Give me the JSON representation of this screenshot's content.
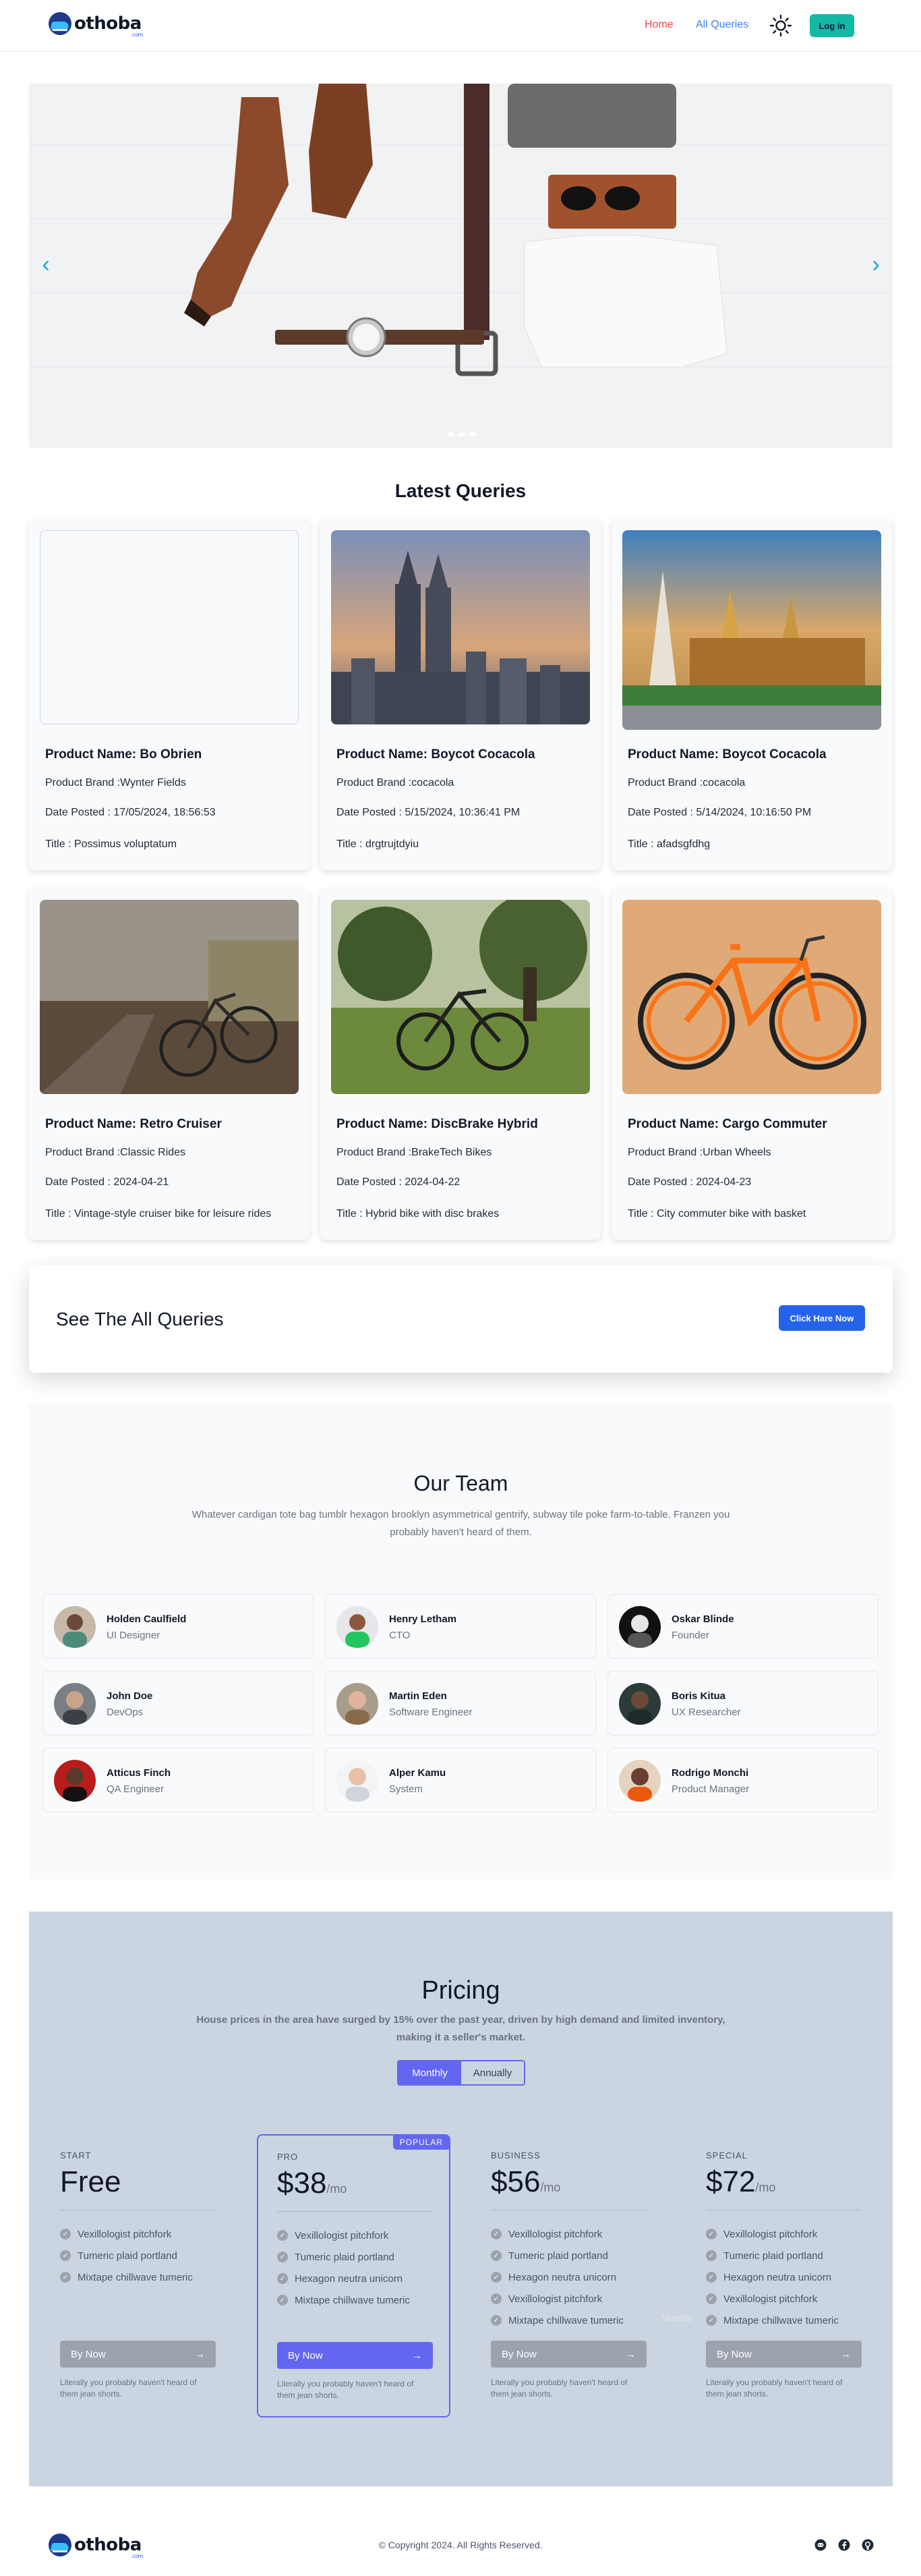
{
  "nav": {
    "logo_text": "othoba",
    "logo_sub": ".com",
    "home_label": "Home",
    "queries_label": "All Queries",
    "theme_icon": "sun-icon",
    "login_label": "Log in"
  },
  "hero": {
    "prev_icon": "chevron-left-icon",
    "next_icon": "chevron-right-icon",
    "slides": 3
  },
  "latest": {
    "heading": "Latest Queries",
    "cards": [
      {
        "name": "Product Name: Bo Obrien",
        "brand": "Product Brand :Wynter Fields",
        "date": "Date Posted : 17/05/2024, 18:56:53",
        "title": "Title : Possimus voluptatum"
      },
      {
        "name": "Product Name: Boycot Cocacola",
        "brand": "Product Brand :cocacola",
        "date": "Date Posted : 5/15/2024, 10:36:41 PM",
        "title": "Title : drgtrujtdyiu"
      },
      {
        "name": "Product Name: Boycot Cocacola",
        "brand": "Product Brand :cocacola",
        "date": "Date Posted : 5/14/2024, 10:16:50 PM",
        "title": "Title : afadsgfdhg"
      },
      {
        "name": "Product Name: Retro Cruiser",
        "brand": "Product Brand :Classic Rides",
        "date": "Date Posted : 2024-04-21",
        "title": "Title : Vintage-style cruiser bike for leisure rides"
      },
      {
        "name": "Product Name: DiscBrake Hybrid",
        "brand": "Product Brand :BrakeTech Bikes",
        "date": "Date Posted : 2024-04-22",
        "title": "Title : Hybrid bike with disc brakes"
      },
      {
        "name": "Product Name: Cargo Commuter",
        "brand": "Product Brand :Urban Wheels",
        "date": "Date Posted : 2024-04-23",
        "title": "Title : City commuter bike with basket"
      }
    ]
  },
  "cta": {
    "label": "See The All Queries",
    "button": "Click Hare Now"
  },
  "team": {
    "heading": "Our Team",
    "description": "Whatever cardigan tote bag tumblr hexagon brooklyn asymmetrical gentrify, subway tile poke farm-to-table. Franzen you probably haven't heard of them.",
    "members": [
      {
        "name": "Holden Caulfield",
        "role": "UI Designer"
      },
      {
        "name": "Henry Letham",
        "role": "CTO"
      },
      {
        "name": "Oskar Blinde",
        "role": "Founder"
      },
      {
        "name": "John Doe",
        "role": "DevOps"
      },
      {
        "name": "Martin Eden",
        "role": "Software Engineer"
      },
      {
        "name": "Boris Kitua",
        "role": "UX Researcher"
      },
      {
        "name": "Atticus Finch",
        "role": "QA Engineer"
      },
      {
        "name": "Alper Kamu",
        "role": "System"
      },
      {
        "name": "Rodrigo Monchi",
        "role": "Product Manager"
      }
    ]
  },
  "pricing": {
    "heading": "Pricing",
    "description": "House prices in the area have surged by 15% over the past year, driven by high demand and limited inventory, making it a seller's market.",
    "toggle_monthly": "Monthly",
    "toggle_annually": "Annually",
    "popular_badge": "POPULAR",
    "ghost_text": "Neutra",
    "plans": [
      {
        "tag": "START",
        "price": "Free",
        "per": "",
        "features": [
          "Vexillologist pitchfork",
          "Tumeric plaid portland",
          "Mixtape chillwave tumeric"
        ],
        "button": "By Now",
        "note": "Literally you probably haven't heard of them jean shorts."
      },
      {
        "tag": "PRO",
        "price": "$38",
        "per": "/mo",
        "features": [
          "Vexillologist pitchfork",
          "Tumeric plaid portland",
          "Hexagon neutra unicorn",
          "Mixtape chillwave tumeric"
        ],
        "button": "By Now",
        "note": "Literally you probably haven't heard of them jean shorts."
      },
      {
        "tag": "BUSINESS",
        "price": "$56",
        "per": "/mo",
        "features": [
          "Vexillologist pitchfork",
          "Tumeric plaid portland",
          "Hexagon neutra unicorn",
          "Vexillologist pitchfork",
          "Mixtape chillwave tumeric"
        ],
        "button": "By Now",
        "note": "Literally you probably haven't heard of them jean shorts."
      },
      {
        "tag": "SPECIAL",
        "price": "$72",
        "per": "/mo",
        "features": [
          "Vexillologist pitchfork",
          "Tumeric plaid portland",
          "Hexagon neutra unicorn",
          "Vexillologist pitchfork",
          "Mixtape chillwave tumeric"
        ],
        "button": "By Now",
        "note": "Literally you probably haven't heard of them jean shorts."
      }
    ]
  },
  "footer": {
    "logo_text": "othoba",
    "logo_sub": ".com",
    "copyright": "© Copyright 2024. All Rights Reserved.",
    "social_icons": [
      "discord-icon",
      "facebook-icon",
      "github-icon"
    ]
  },
  "colors": {
    "accent_blue": "#2563eb",
    "teal": "#14b8a6",
    "indigo": "#6366f1",
    "home_red": "#ef4444",
    "pricing_bg": "#cbd5e1"
  }
}
